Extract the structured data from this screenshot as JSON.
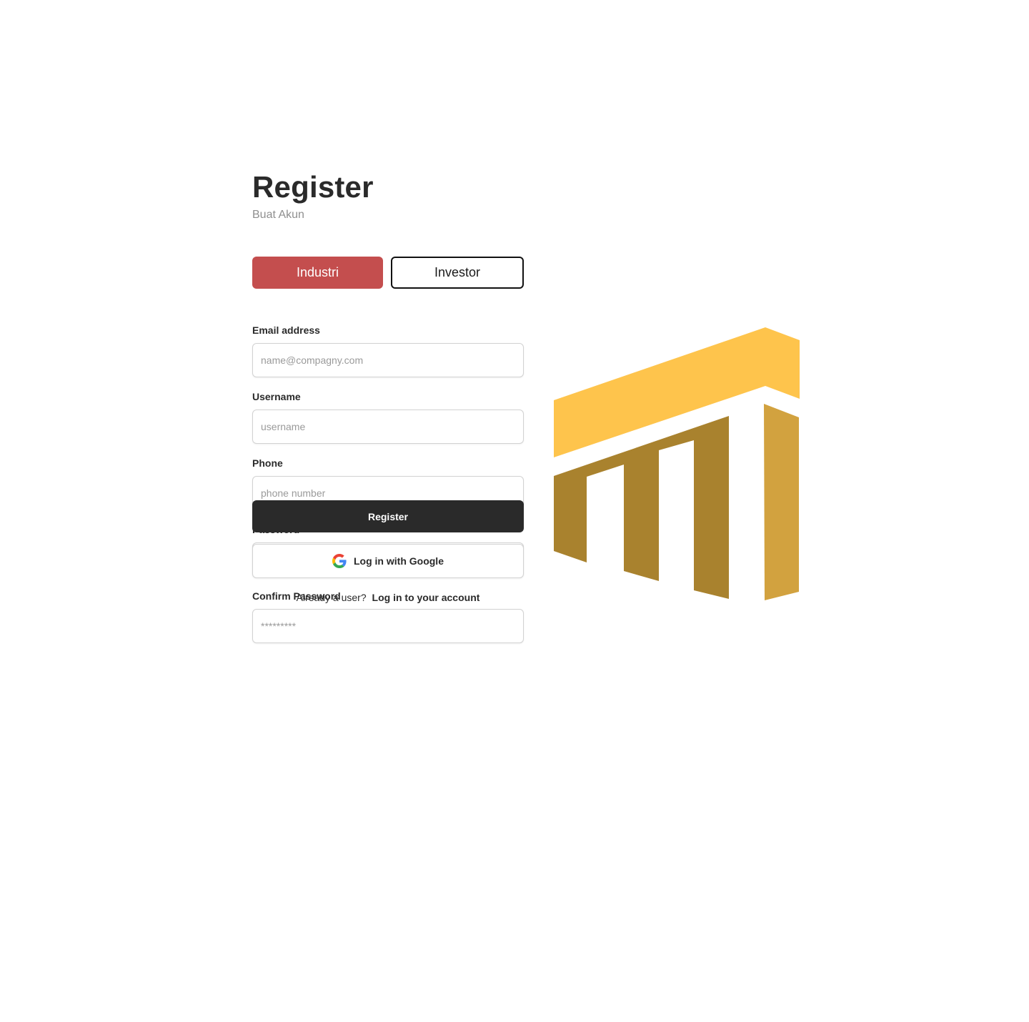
{
  "header": {
    "title": "Register",
    "subtitle": "Buat Akun"
  },
  "role_toggle": {
    "options": [
      "Industri",
      "Investor"
    ],
    "selected": "Industri"
  },
  "form": {
    "fields": [
      {
        "label": "Email address",
        "placeholder": "name@compagny.com",
        "value": ""
      },
      {
        "label": "Username",
        "placeholder": "username",
        "value": ""
      },
      {
        "label": "Phone",
        "placeholder": "phone number",
        "value": ""
      },
      {
        "label": "Password",
        "placeholder": "*********",
        "value": ""
      },
      {
        "label": "Confirm Password",
        "placeholder": "*********",
        "value": ""
      }
    ],
    "submit_label": "Register",
    "google_label": "Log in with Google",
    "google_icon": "google-icon"
  },
  "footer": {
    "prompt": "Already a user?",
    "link": "Log in to your account"
  },
  "logo": {
    "icon": "brand-logo-building-icon"
  },
  "colors": {
    "accent_red": "#c44e4e",
    "dark": "#2a2a2a",
    "logo_light": "#fec44c",
    "logo_dark": "#a9822e",
    "logo_mid": "#d2a23f"
  }
}
